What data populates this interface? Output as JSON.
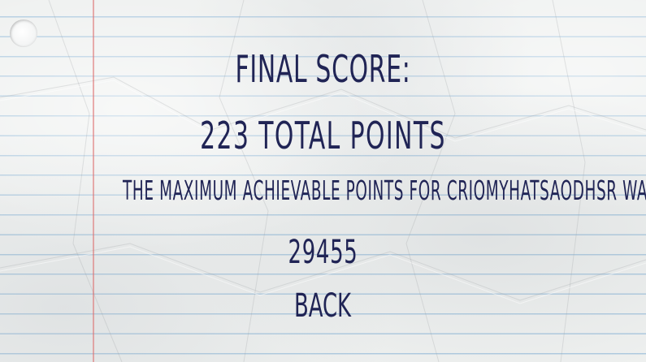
{
  "score_screen": {
    "heading": "FINAL SCORE:",
    "total_points": "223 TOTAL POINTS",
    "max_points_text": "THE MAXIMUM ACHIEVABLE POINTS FOR CRIOMYHATSAODHSR WAS:",
    "max_points_value": "29455",
    "back_label": "BACK"
  },
  "colors": {
    "text": "#202455",
    "paper": "#eef0ef",
    "ruled_line": "#78aad2",
    "margin_line": "#dc6e6e"
  }
}
